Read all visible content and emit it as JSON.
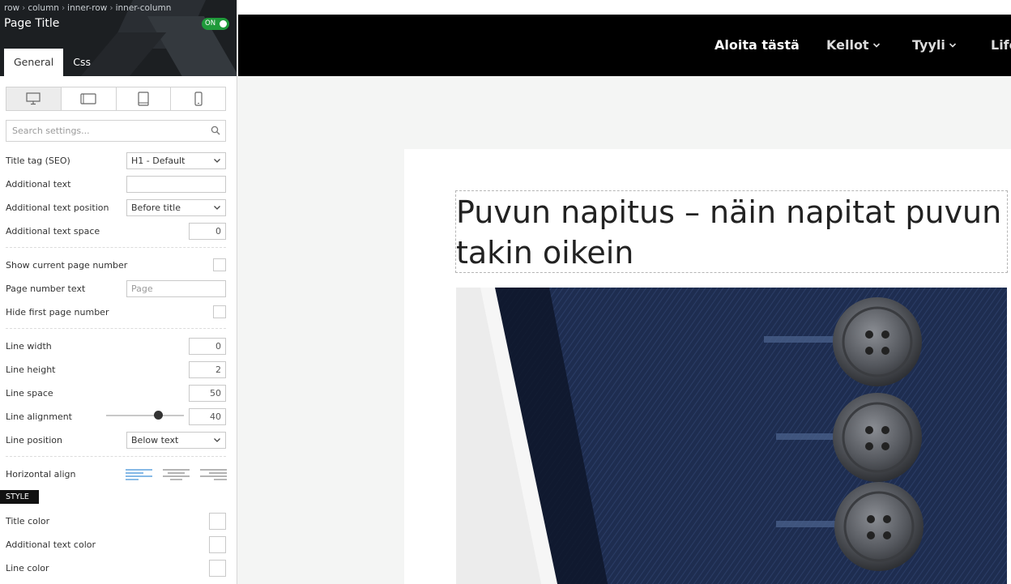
{
  "panel": {
    "breadcrumb": [
      "row",
      "column",
      "inner-row",
      "inner-column"
    ],
    "title": "Page Title",
    "toggle_label": "ON",
    "tabs": [
      {
        "label": "General",
        "active": true
      },
      {
        "label": "Css",
        "active": false
      }
    ],
    "devices": [
      {
        "icon": "desktop-icon",
        "active": true
      },
      {
        "icon": "tablet-landscape-icon",
        "active": false
      },
      {
        "icon": "tablet-portrait-icon",
        "active": false
      },
      {
        "icon": "mobile-icon",
        "active": false
      }
    ],
    "search": {
      "placeholder": "Search settings..."
    },
    "fields": {
      "title_tag": {
        "label": "Title tag (SEO)",
        "value": "H1 - Default"
      },
      "additional_text": {
        "label": "Additional text",
        "value": ""
      },
      "additional_text_position": {
        "label": "Additional text position",
        "value": "Before title"
      },
      "additional_text_space": {
        "label": "Additional text space",
        "value": "0"
      },
      "show_current_page_number": {
        "label": "Show current page number",
        "checked": false
      },
      "page_number_text": {
        "label": "Page number text",
        "placeholder": "Page"
      },
      "hide_first_page_number": {
        "label": "Hide first page number",
        "checked": false
      },
      "line_width": {
        "label": "Line width",
        "value": "0"
      },
      "line_height": {
        "label": "Line height",
        "value": "2"
      },
      "line_space": {
        "label": "Line space",
        "value": "50"
      },
      "line_alignment": {
        "label": "Line alignment",
        "value": "40"
      },
      "line_position": {
        "label": "Line position",
        "value": "Below text"
      },
      "horizontal_align": {
        "label": "Horizontal align",
        "selected": "left"
      }
    },
    "style_section": "STYLE",
    "style_fields": {
      "title_color": {
        "label": "Title color"
      },
      "additional_text_color": {
        "label": "Additional text color"
      },
      "line_color": {
        "label": "Line color"
      }
    }
  },
  "preview": {
    "nav": [
      {
        "label": "Aloita tästä",
        "dropdown": false
      },
      {
        "label": "Kellot",
        "dropdown": true
      },
      {
        "label": "Tyyli",
        "dropdown": true
      },
      {
        "label": "Life",
        "dropdown": false
      }
    ],
    "article_title": "Puvun napitus – näin napitat puvun takin oikein",
    "colors": {
      "nav_bg": "#000000",
      "toggle_on": "#1f9a3a",
      "align_active": "#3d8fd6",
      "jacket": "#1f2f52"
    }
  }
}
